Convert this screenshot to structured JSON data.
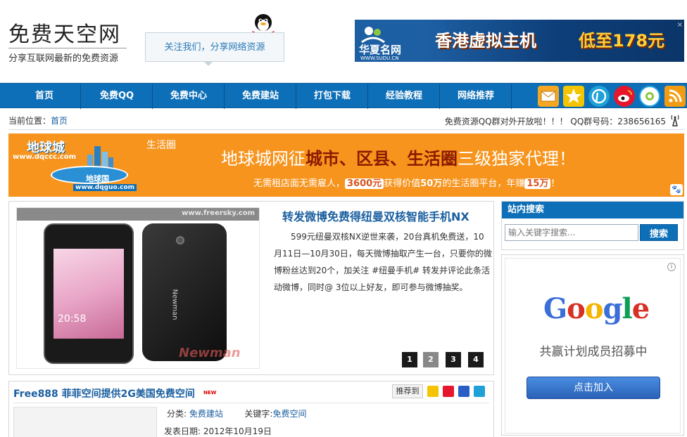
{
  "site": {
    "title": "免费天空网",
    "subtitle": "分享互联网最新的免费资源",
    "follow_text": "关注我们，分享网络资源"
  },
  "header_ad": {
    "brand_name": "华夏名网",
    "brand_url": "WWW.SUDU.CN",
    "main_text": "香港虚拟主机",
    "price_text": "低至178元"
  },
  "nav": {
    "items": [
      {
        "label": "首页"
      },
      {
        "label": "免费QQ"
      },
      {
        "label": "免费中心"
      },
      {
        "label": "免费建站"
      },
      {
        "label": "打包下载"
      },
      {
        "label": "经验教程"
      },
      {
        "label": "网络推荐"
      }
    ],
    "icons": [
      "mail-icon",
      "star-icon",
      "pinterest-icon",
      "weibo-icon",
      "tencent-weibo-icon",
      "rss-icon"
    ]
  },
  "location": {
    "prefix": "当前位置：",
    "home": "首页",
    "notice": "免费资源QQ群对外开放啦！！！ QQ群号码：238656165"
  },
  "banner": {
    "logo_top": "地球城",
    "url_top": "www.dqccc.com",
    "life_label": "生活圈",
    "logo_bottom": "地球国",
    "url_bottom": "www.dqguo.com",
    "headline_pre": "地球城网征",
    "headline_hl": "城市、区县、生活圈",
    "headline_post": "三级独家代理！",
    "sub_pre": "无需租店面无需雇人，",
    "sub_price": "3600元",
    "sub_mid": "获得价值",
    "sub_value": "50万",
    "sub_mid2": "的生活圈平台，年赚",
    "sub_earn": "15万",
    "sub_end": "！"
  },
  "feature": {
    "watermark": "www.freersky.com",
    "phone_time": "20:58",
    "brand": "Newman",
    "title": "转发微博免费得纽曼双核智能手机NX",
    "body": "599元纽曼双核NX逆世来袭，20台真机免费送，10月11日—10月30日，每天微博抽取产生一台，只要你的微博粉丝达到20个，加关注 #纽曼手机# 转发并评论此条活动微博，同时@ 3位以上好友，即可参与微博抽奖。",
    "pages": [
      "1",
      "2",
      "3",
      "4"
    ],
    "active_page": "2"
  },
  "article": {
    "title": "Free888 菲菲空间提供2G美国免费空间",
    "new_badge": "NEW",
    "share_label": "推荐到",
    "category_label": "分类:",
    "category": "免费建站",
    "keyword_label": "关键字:",
    "keyword": "免费空间",
    "date_label": "发表日期:",
    "date": "2012年10月19日"
  },
  "sidebar": {
    "search_title": "站内搜索",
    "search_placeholder": "输入关键字搜索...",
    "search_button": "搜索",
    "google_sub": "共赢计划成员招募中",
    "google_button": "点击加入",
    "info_icon": "i"
  },
  "colors": {
    "nav_blue": "#0d6fb8",
    "banner_orange": "#f7941d",
    "link_blue": "#1a5fa0"
  }
}
